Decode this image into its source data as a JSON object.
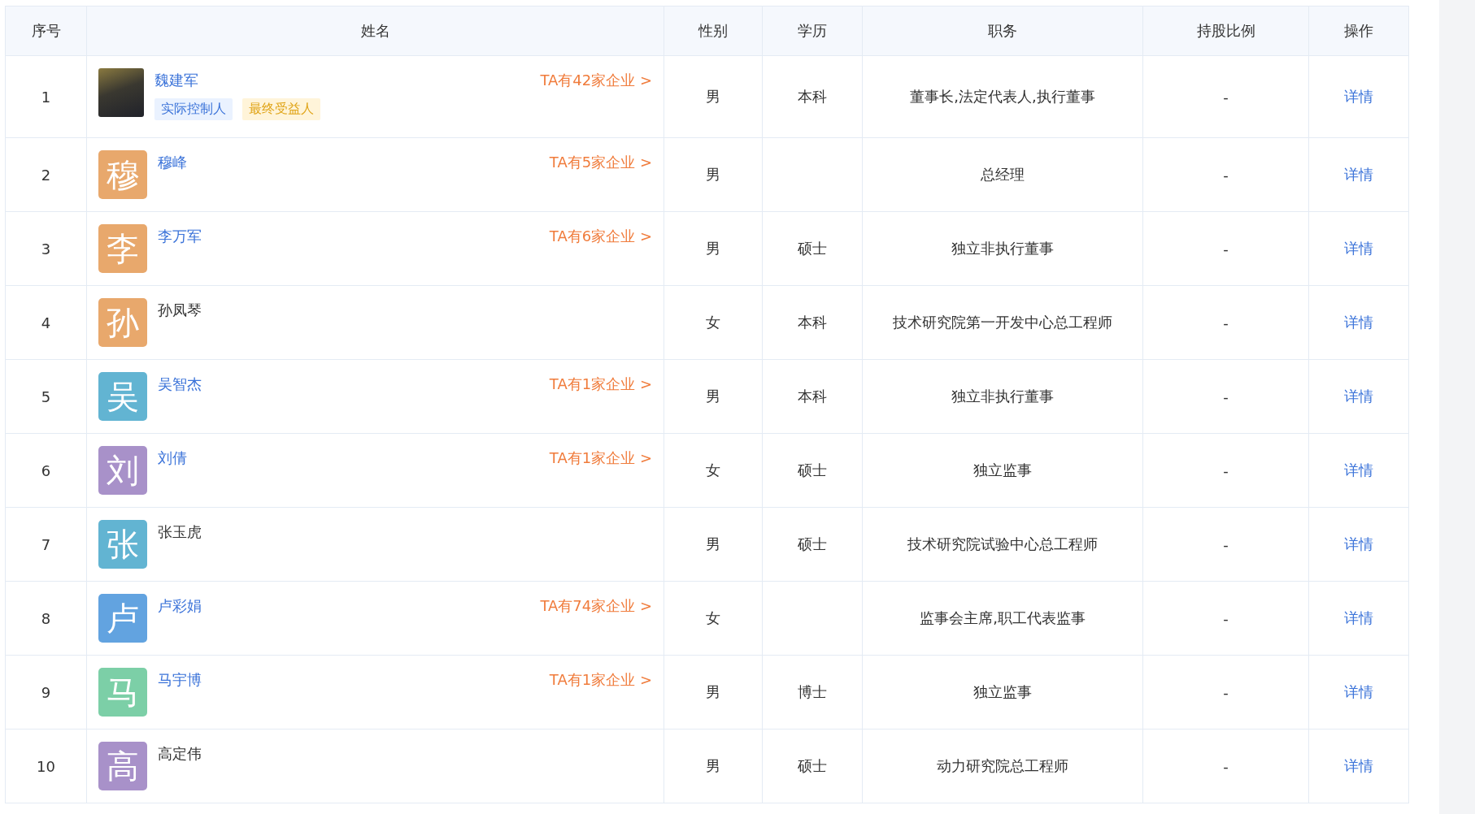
{
  "table": {
    "columns": [
      "序号",
      "姓名",
      "性别",
      "学历",
      "职务",
      "持股比例",
      "操作"
    ],
    "rows": [
      {
        "index": "1",
        "avatar": {
          "kind": "photo"
        },
        "name": "魏建军",
        "linked": true,
        "companies": "TA有42家企业 >",
        "tags": [
          {
            "label": "实际控制人",
            "kind": "controller"
          },
          {
            "label": "最终受益人",
            "kind": "beneficiary"
          }
        ],
        "gender": "男",
        "education": "本科",
        "position": "董事长,法定代表人,执行董事",
        "share": "-",
        "action": "详情"
      },
      {
        "index": "2",
        "avatar": {
          "kind": "letter",
          "char": "穆",
          "color": "#e8a86c"
        },
        "name": "穆峰",
        "linked": true,
        "companies": "TA有5家企业 >",
        "gender": "男",
        "education": "",
        "position": "总经理",
        "share": "-",
        "action": "详情"
      },
      {
        "index": "3",
        "avatar": {
          "kind": "letter",
          "char": "李",
          "color": "#e8a86c"
        },
        "name": "李万军",
        "linked": true,
        "companies": "TA有6家企业 >",
        "gender": "男",
        "education": "硕士",
        "position": "独立非执行董事",
        "share": "-",
        "action": "详情"
      },
      {
        "index": "4",
        "avatar": {
          "kind": "letter",
          "char": "孙",
          "color": "#e8a86c"
        },
        "name": "孙凤琴",
        "linked": false,
        "gender": "女",
        "education": "本科",
        "position": "技术研究院第一开发中心总工程师",
        "share": "-",
        "action": "详情"
      },
      {
        "index": "5",
        "avatar": {
          "kind": "letter",
          "char": "吴",
          "color": "#62b4d2"
        },
        "name": "吴智杰",
        "linked": true,
        "companies": "TA有1家企业 >",
        "gender": "男",
        "education": "本科",
        "position": "独立非执行董事",
        "share": "-",
        "action": "详情"
      },
      {
        "index": "6",
        "avatar": {
          "kind": "letter",
          "char": "刘",
          "color": "#a891c9"
        },
        "name": "刘倩",
        "linked": true,
        "companies": "TA有1家企业 >",
        "gender": "女",
        "education": "硕士",
        "position": "独立监事",
        "share": "-",
        "action": "详情"
      },
      {
        "index": "7",
        "avatar": {
          "kind": "letter",
          "char": "张",
          "color": "#62b4d2"
        },
        "name": "张玉虎",
        "linked": false,
        "gender": "男",
        "education": "硕士",
        "position": "技术研究院试验中心总工程师",
        "share": "-",
        "action": "详情"
      },
      {
        "index": "8",
        "avatar": {
          "kind": "letter",
          "char": "卢",
          "color": "#62a3e0"
        },
        "name": "卢彩娟",
        "linked": true,
        "companies": "TA有74家企业 >",
        "gender": "女",
        "education": "",
        "position": "监事会主席,职工代表监事",
        "share": "-",
        "action": "详情"
      },
      {
        "index": "9",
        "avatar": {
          "kind": "letter",
          "char": "马",
          "color": "#7ccfa7"
        },
        "name": "马宇博",
        "linked": true,
        "companies": "TA有1家企业 >",
        "gender": "男",
        "education": "博士",
        "position": "独立监事",
        "share": "-",
        "action": "详情"
      },
      {
        "index": "10",
        "avatar": {
          "kind": "letter",
          "char": "高",
          "color": "#a891c9"
        },
        "name": "高定伟",
        "linked": false,
        "gender": "男",
        "education": "硕士",
        "position": "动力研究院总工程师",
        "share": "-",
        "action": "详情"
      }
    ]
  }
}
